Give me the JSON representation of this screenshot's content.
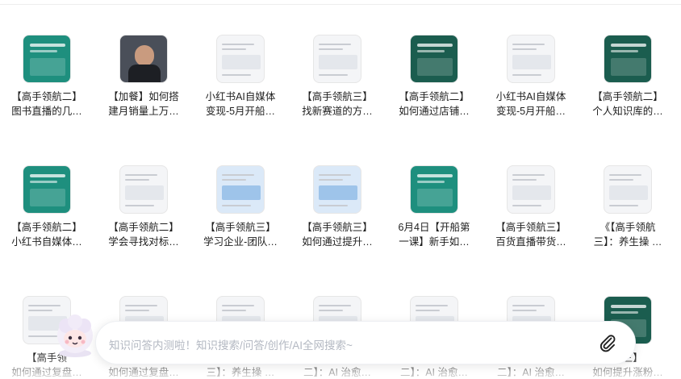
{
  "items": [
    {
      "title": [
        "【高手领航二】",
        "图书直播的几…"
      ],
      "thumb": "teal"
    },
    {
      "title": [
        "【加餐】如何搭",
        "建月销量上万…"
      ],
      "thumb": "photo"
    },
    {
      "title": [
        "小红书AI自媒体",
        "变现-5月开船…"
      ],
      "thumb": "white"
    },
    {
      "title": [
        "【高手领航三】",
        "找新赛道的方…"
      ],
      "thumb": "white"
    },
    {
      "title": [
        "【高手领航二】",
        "如何通过店铺…"
      ],
      "thumb": "dark"
    },
    {
      "title": [
        "小红书AI自媒体",
        "变现-5月开船…"
      ],
      "thumb": "white"
    },
    {
      "title": [
        "【高手领航二】",
        "个人知识库的…"
      ],
      "thumb": "dark"
    },
    {
      "title": [
        "【高手领航二】",
        "小红书自媒体…"
      ],
      "thumb": "teal"
    },
    {
      "title": [
        "【高手领航二】",
        "学会寻找对标…"
      ],
      "thumb": "white"
    },
    {
      "title": [
        "【高手领航三】",
        "学习企业-团队…"
      ],
      "thumb": "blue"
    },
    {
      "title": [
        "【高手领航三】",
        "如何通过提升…"
      ],
      "thumb": "blue"
    },
    {
      "title": [
        "6月4日【开船第",
        "一课】新手如…"
      ],
      "thumb": "teal"
    },
    {
      "title": [
        "【高手领航三】",
        "百货直播带货…"
      ],
      "thumb": "white"
    },
    {
      "title": [
        "《【高手领航",
        "三】：养生操 …"
      ],
      "thumb": "white"
    },
    {
      "title": [
        "【高手领",
        "如何通过复盘…"
      ],
      "thumb": "white"
    },
    {
      "title": [
        "",
        "如何通过复盘…"
      ],
      "thumb": "white"
    },
    {
      "title": [
        "",
        "三】：养生操 …"
      ],
      "thumb": "white"
    },
    {
      "title": [
        "",
        "二】：AI 治愈…"
      ],
      "thumb": "white"
    },
    {
      "title": [
        "",
        "二】：AI 治愈…"
      ],
      "thumb": "white"
    },
    {
      "title": [
        "",
        "二】：AI 治愈…"
      ],
      "thumb": "white"
    },
    {
      "title": [
        "航三】",
        "如何提升涨粉…"
      ],
      "thumb": "dark"
    }
  ],
  "askbar": {
    "placeholder": "知识问答内测啦！知识搜索/问答/创作/AI全网搜索~"
  },
  "icons": {
    "attach": "paperclip-icon",
    "mascot": "mascot-icon"
  },
  "colors": {
    "teal": "#1e8f7e",
    "dark_green": "#1b5d4f",
    "placeholder": "#b3b8c2"
  }
}
